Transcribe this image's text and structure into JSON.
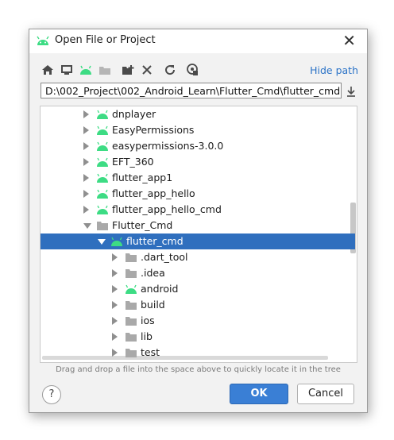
{
  "window": {
    "title": "Open File or Project"
  },
  "toolbar": {
    "icons": [
      "home-icon",
      "desktop-icon",
      "android-project-icon",
      "module-folder-icon",
      "new-folder-icon",
      "delete-icon",
      "refresh-icon",
      "show-hidden-icon"
    ],
    "hide_path_label": "Hide path"
  },
  "path": {
    "value": "D:\\002_Project\\002_Android_Learn\\Flutter_Cmd\\flutter_cmd"
  },
  "tree": {
    "items": [
      {
        "label": "dnplayer",
        "icon": "android-icon",
        "expanded": false
      },
      {
        "label": "EasyPermissions",
        "icon": "android-icon",
        "expanded": false
      },
      {
        "label": "easypermissions-3.0.0",
        "icon": "android-icon",
        "expanded": false
      },
      {
        "label": "EFT_360",
        "icon": "android-icon",
        "expanded": false
      },
      {
        "label": "flutter_app1",
        "icon": "android-icon",
        "expanded": false
      },
      {
        "label": "flutter_app_hello",
        "icon": "android-icon",
        "expanded": false
      },
      {
        "label": "flutter_app_hello_cmd",
        "icon": "android-icon",
        "expanded": false
      },
      {
        "label": "Flutter_Cmd",
        "icon": "folder-icon",
        "expanded": true
      },
      {
        "label": "flutter_cmd",
        "icon": "android-icon",
        "expanded": true,
        "selected": true
      },
      {
        "label": ".dart_tool",
        "icon": "folder-icon",
        "expanded": false
      },
      {
        "label": ".idea",
        "icon": "folder-icon",
        "expanded": false
      },
      {
        "label": "android",
        "icon": "android-icon",
        "expanded": false
      },
      {
        "label": "build",
        "icon": "folder-icon",
        "expanded": false
      },
      {
        "label": "ios",
        "icon": "folder-icon",
        "expanded": false
      },
      {
        "label": "lib",
        "icon": "folder-icon",
        "expanded": false
      },
      {
        "label": "test",
        "icon": "folder-icon",
        "expanded": false
      }
    ]
  },
  "hint": "Drag and drop a file into the space above to quickly locate it in the tree",
  "buttons": {
    "help": "?",
    "ok": "OK",
    "cancel": "Cancel"
  },
  "colors": {
    "android_green": "#3ddc84",
    "selection": "#2f6fbe",
    "link": "#2b73c7",
    "ok": "#3a7fd5"
  }
}
